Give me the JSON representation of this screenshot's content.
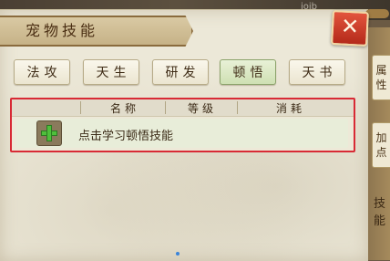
{
  "window": {
    "title": "宠物技能",
    "close_label": "✕",
    "tabs": [
      {
        "label": "法攻",
        "active": false
      },
      {
        "label": "天生",
        "active": false
      },
      {
        "label": "研发",
        "active": false
      },
      {
        "label": "顿悟",
        "active": true
      },
      {
        "label": "天书",
        "active": false
      }
    ]
  },
  "skills_table": {
    "columns": [
      "名称",
      "等级",
      "消耗"
    ],
    "rows": [
      {
        "action_icon": "plus-icon",
        "text": "点击学习顿悟技能"
      }
    ]
  },
  "side": {
    "tab1": "属性",
    "tab2": "加点",
    "label": "技能"
  },
  "scene": {
    "deco": "ioib"
  },
  "colors": {
    "highlight_border": "#d82a35",
    "active_tab": "#cfe0b3",
    "close_button": "#c9341f"
  }
}
